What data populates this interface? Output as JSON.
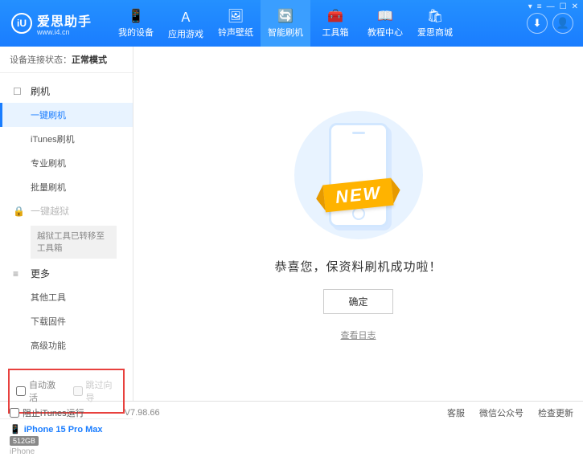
{
  "header": {
    "logo_text": "爱思助手",
    "logo_url": "www.i4.cn",
    "nav": [
      "我的设备",
      "应用游戏",
      "铃声壁纸",
      "智能刷机",
      "工具箱",
      "教程中心",
      "爱思商城"
    ],
    "active_nav_index": 3
  },
  "sidebar": {
    "status_label": "设备连接状态：",
    "status_value": "正常模式",
    "sec_flash": "刷机",
    "items_flash": [
      "一键刷机",
      "iTunes刷机",
      "专业刷机",
      "批量刷机"
    ],
    "sec_jail": "一键越狱",
    "jail_note": "越狱工具已转移至工具箱",
    "sec_more": "更多",
    "items_more": [
      "其他工具",
      "下载固件",
      "高级功能"
    ],
    "check_auto": "自动激活",
    "check_skip": "跳过向导",
    "device_name": "iPhone 15 Pro Max",
    "device_storage": "512GB",
    "device_type": "iPhone"
  },
  "main": {
    "ribbon": "NEW",
    "success": "恭喜您，保资料刷机成功啦！",
    "ok": "确定",
    "log": "查看日志"
  },
  "footer": {
    "block_itunes": "阻止iTunes运行",
    "version": "V7.98.66",
    "service": "客服",
    "wechat": "微信公众号",
    "update": "检查更新"
  }
}
